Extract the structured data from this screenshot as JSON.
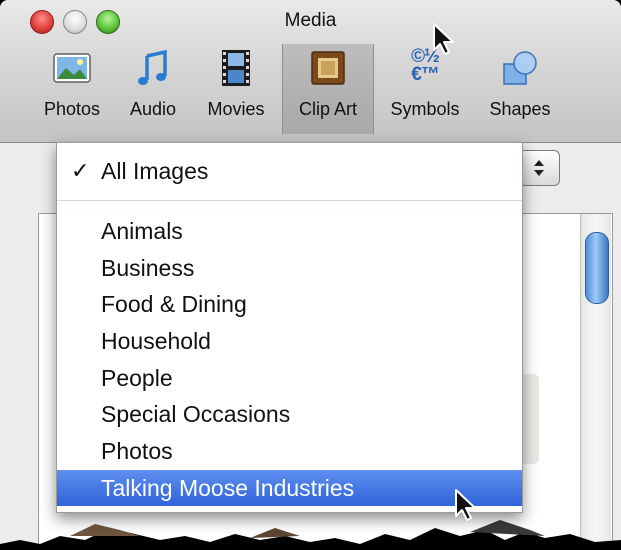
{
  "window": {
    "title": "Media"
  },
  "toolbar": {
    "items": [
      {
        "label": "Photos",
        "icon": "photos-icon"
      },
      {
        "label": "Audio",
        "icon": "music-note-icon"
      },
      {
        "label": "Movies",
        "icon": "film-strip-icon"
      },
      {
        "label": "Clip Art",
        "icon": "clip-art-icon",
        "selected": true
      },
      {
        "label": "Symbols",
        "icon": "symbols-icon",
        "glyph": "©½€™"
      },
      {
        "label": "Shapes",
        "icon": "shapes-icon"
      }
    ]
  },
  "popup": {
    "selected": "All Images",
    "items": [
      {
        "label": "All Images",
        "checked": true
      },
      {
        "label": "Animals"
      },
      {
        "label": "Business"
      },
      {
        "label": "Food & Dining"
      },
      {
        "label": "Household"
      },
      {
        "label": "People"
      },
      {
        "label": "Special Occasions"
      },
      {
        "label": "Photos"
      },
      {
        "label": "Talking Moose Industries",
        "highlighted": true
      }
    ],
    "check_glyph": "✓"
  },
  "colors": {
    "highlight": "#3a6ee0",
    "close": "#e0413d",
    "zoom": "#5ec43b"
  }
}
